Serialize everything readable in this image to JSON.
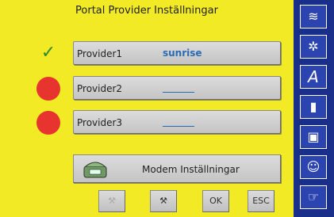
{
  "title": "Portal Provider Inställningar",
  "providers": [
    {
      "label": "Provider1",
      "value": "sunrise",
      "status": "check"
    },
    {
      "label": "Provider2",
      "value": "",
      "status": "error"
    },
    {
      "label": "Provider3",
      "value": "",
      "status": "error"
    }
  ],
  "modem": {
    "label": "Modem Inställningar",
    "icon": "modem-phone-icon"
  },
  "bottom": {
    "ok": "OK",
    "esc": "ESC",
    "icon1": "tool-icon-disabled",
    "icon2": "tool-icon"
  },
  "sidebar": {
    "icons": [
      "stitch-icon",
      "embroidery-icon",
      "text-A-icon",
      "bar-icon",
      "frame-icon",
      "smiley-icon",
      "settings-icon"
    ],
    "text_icon": "A"
  },
  "colors": {
    "background": "#f2ea24",
    "sidebar": "#1a2f8a",
    "link": "#2b6bb5",
    "error": "#e8342f",
    "ok": "#2e8b2e"
  }
}
